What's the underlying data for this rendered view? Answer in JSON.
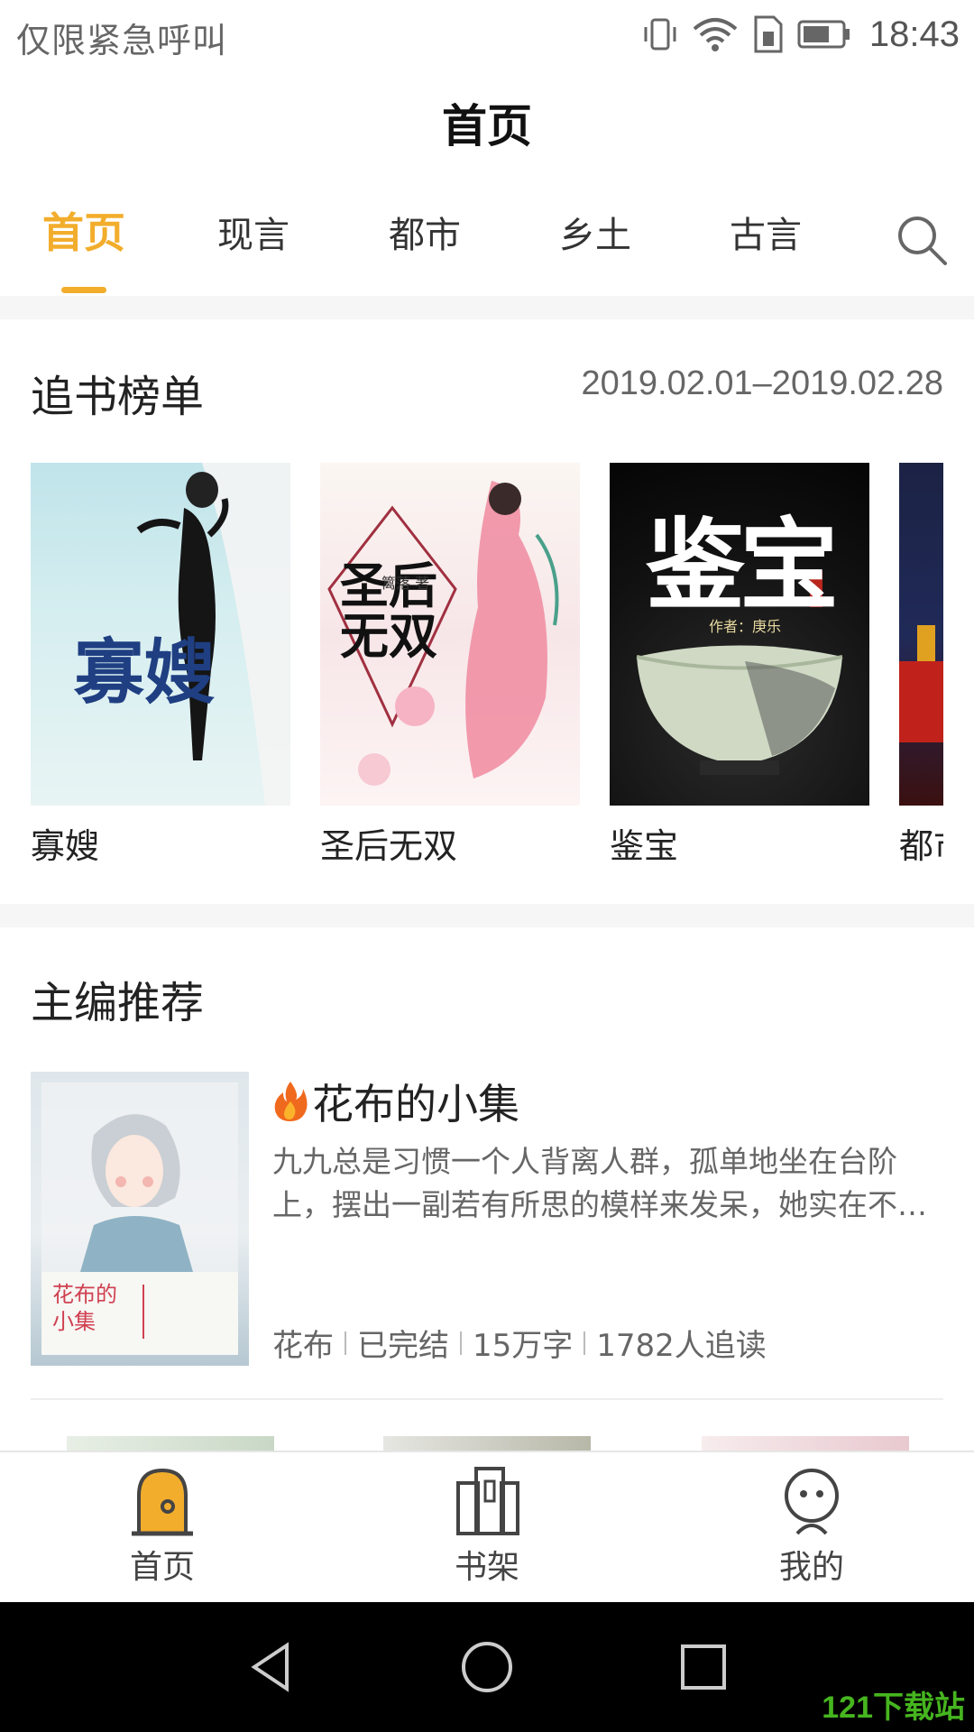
{
  "status_bar": {
    "carrier_text": "仅限紧急呼叫",
    "time": "18:43",
    "icons": [
      "vibrate-icon",
      "wifi-icon",
      "sim-icon",
      "battery-icon"
    ]
  },
  "header": {
    "title": "首页"
  },
  "tabs": [
    {
      "label": "首页",
      "active": true
    },
    {
      "label": "现言",
      "active": false
    },
    {
      "label": "都市",
      "active": false
    },
    {
      "label": "乡土",
      "active": false
    },
    {
      "label": "古言",
      "active": false
    }
  ],
  "ranking": {
    "title": "追书榜单",
    "date_range": "2019.02.01–2019.02.28",
    "books": [
      {
        "title": "寡嫂",
        "cover_text": "寡嫂"
      },
      {
        "title": "圣后无双",
        "cover_text": "圣后无双",
        "cover_author": "篱落 著"
      },
      {
        "title": "鉴宝",
        "cover_text": "鉴宝",
        "cover_author": "作者：庚乐"
      },
      {
        "title": "都市",
        "cover_text": ""
      }
    ]
  },
  "editor_pick": {
    "title": "主编推荐",
    "book": {
      "title": "花布的小集",
      "description": "九九总是习惯一个人背离人群，孤单地坐在台阶上，摆出一副若有所思的模样来发呆，她实在不…",
      "author": "花布",
      "status": "已完结",
      "word_count": "15万字",
      "followers": "1782人追读",
      "cover_text": "花布的小集"
    }
  },
  "bottom_nav": [
    {
      "label": "首页",
      "icon": "home-door-icon",
      "active": true
    },
    {
      "label": "书架",
      "icon": "bookshelf-icon",
      "active": false
    },
    {
      "label": "我的",
      "icon": "profile-icon",
      "active": false
    }
  ],
  "colors": {
    "accent": "#f2ad2c",
    "text": "#222222",
    "muted": "#666666"
  },
  "watermark": "121下载站"
}
